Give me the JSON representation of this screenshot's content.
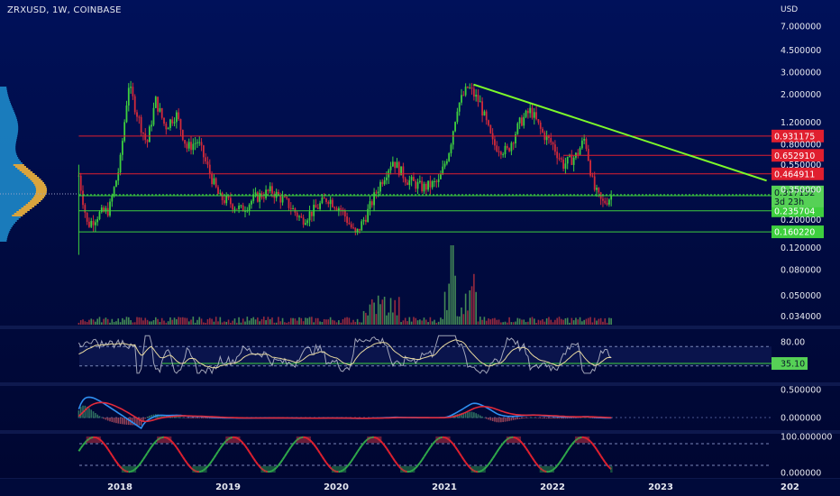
{
  "symbol_title": "ZRXUSD, 1W, COINBASE",
  "currency": "USD",
  "colors": {
    "up": "#3ecf3e",
    "down": "#d22a3a",
    "trend": "#7dfa2a",
    "support": "#3ecf3e",
    "resistance": "#e01f2f",
    "bg": "#00115a"
  },
  "chart_data": [
    {
      "type": "candlestick",
      "title": "ZRXUSD, 1W, COINBASE",
      "yscale": "log",
      "ylim": [
        0.028,
        11.0
      ],
      "x_ticks": [
        "2018",
        "2019",
        "2020",
        "2021",
        "2022",
        "2023",
        "202"
      ],
      "y_ticks": [
        "7.000000",
        "4.500000",
        "3.000000",
        "2.000000",
        "1.200000",
        "0.800000",
        "0.550000",
        "0.350000",
        "0.200000",
        "0.120000",
        "0.080000",
        "0.050000",
        "0.034000"
      ],
      "anchors": [
        {
          "t": 2017.62,
          "v": 0.45
        },
        {
          "t": 2017.7,
          "v": 0.18
        },
        {
          "t": 2017.8,
          "v": 0.22
        },
        {
          "t": 2017.9,
          "v": 0.24
        },
        {
          "t": 2018.0,
          "v": 0.55
        },
        {
          "t": 2018.08,
          "v": 2.4
        },
        {
          "t": 2018.16,
          "v": 1.4
        },
        {
          "t": 2018.25,
          "v": 0.8
        },
        {
          "t": 2018.33,
          "v": 1.8
        },
        {
          "t": 2018.42,
          "v": 1.1
        },
        {
          "t": 2018.52,
          "v": 1.4
        },
        {
          "t": 2018.62,
          "v": 0.75
        },
        {
          "t": 2018.72,
          "v": 0.85
        },
        {
          "t": 2018.82,
          "v": 0.5
        },
        {
          "t": 2018.92,
          "v": 0.3
        },
        {
          "t": 2019.0,
          "v": 0.28
        },
        {
          "t": 2019.12,
          "v": 0.24
        },
        {
          "t": 2019.25,
          "v": 0.3
        },
        {
          "t": 2019.4,
          "v": 0.34
        },
        {
          "t": 2019.55,
          "v": 0.27
        },
        {
          "t": 2019.68,
          "v": 0.2
        },
        {
          "t": 2019.8,
          "v": 0.24
        },
        {
          "t": 2019.92,
          "v": 0.3
        },
        {
          "t": 2020.05,
          "v": 0.24
        },
        {
          "t": 2020.18,
          "v": 0.15
        },
        {
          "t": 2020.28,
          "v": 0.22
        },
        {
          "t": 2020.4,
          "v": 0.38
        },
        {
          "t": 2020.52,
          "v": 0.6
        },
        {
          "t": 2020.65,
          "v": 0.42
        },
        {
          "t": 2020.8,
          "v": 0.36
        },
        {
          "t": 2020.95,
          "v": 0.4
        },
        {
          "t": 2021.05,
          "v": 0.75
        },
        {
          "t": 2021.12,
          "v": 1.6
        },
        {
          "t": 2021.22,
          "v": 2.3
        },
        {
          "t": 2021.33,
          "v": 1.7
        },
        {
          "t": 2021.45,
          "v": 0.8
        },
        {
          "t": 2021.58,
          "v": 0.7
        },
        {
          "t": 2021.7,
          "v": 1.2
        },
        {
          "t": 2021.8,
          "v": 1.5
        },
        {
          "t": 2021.9,
          "v": 1.0
        },
        {
          "t": 2022.0,
          "v": 0.8
        },
        {
          "t": 2022.1,
          "v": 0.55
        },
        {
          "t": 2022.22,
          "v": 0.65
        },
        {
          "t": 2022.3,
          "v": 0.9
        },
        {
          "t": 2022.38,
          "v": 0.36
        },
        {
          "t": 2022.46,
          "v": 0.27
        },
        {
          "t": 2022.56,
          "v": 0.317
        }
      ],
      "trendline": [
        {
          "t": 2021.27,
          "v": 2.4
        },
        {
          "t": 2023.98,
          "v": 0.41
        }
      ],
      "levels": [
        {
          "value": 0.931175,
          "label": "0.931175",
          "kind": "resistance",
          "from": 2017.62
        },
        {
          "value": 0.65291,
          "label": "0.652910",
          "kind": "resistance",
          "from": 2022.1
        },
        {
          "value": 0.464911,
          "label": "0.464911",
          "kind": "resistance",
          "from": 2017.62
        },
        {
          "value": 0.311213,
          "label": "0.311213",
          "kind": "support",
          "from": 2017.62
        },
        {
          "value": 0.235704,
          "label": "0.235704",
          "kind": "support",
          "from": 2017.62
        },
        {
          "value": 0.16022,
          "label": "0.160220",
          "kind": "support",
          "from": 2017.62
        }
      ],
      "last_price": {
        "value": 0.317152,
        "label": "0.317152",
        "countdown": "3d 23h"
      }
    },
    {
      "type": "line",
      "name": "RSI",
      "y_ticks": [
        "80.00"
      ],
      "last_label": "35.10"
    },
    {
      "type": "line",
      "name": "MACD",
      "y_ticks": [
        "0.500000",
        "0.000000"
      ]
    },
    {
      "type": "line",
      "name": "Stochastic",
      "y_ticks": [
        "100.000000",
        "0.000000"
      ]
    }
  ]
}
